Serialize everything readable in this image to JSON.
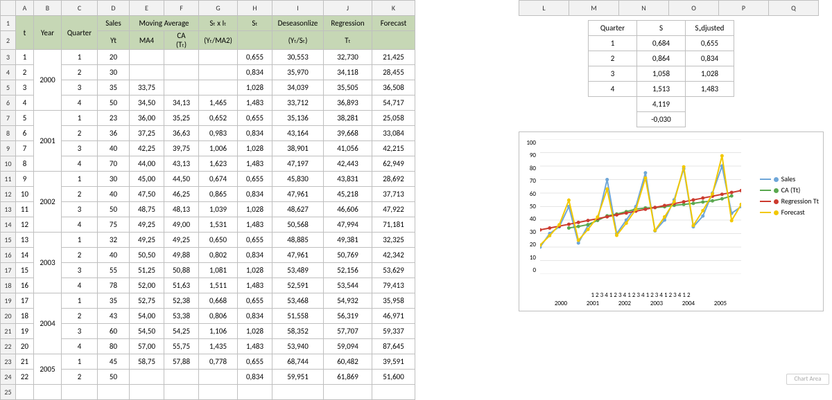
{
  "cols": [
    "A",
    "B",
    "C",
    "D",
    "E",
    "F",
    "G",
    "H",
    "I",
    "J",
    "K",
    "L",
    "M",
    "N",
    "O",
    "P",
    "Q"
  ],
  "highlight_col": 15,
  "headers": {
    "t": "t",
    "year": "Year",
    "quarter": "Quarter",
    "sales": "Sales",
    "ma": "Moving Average",
    "yt": "Yt",
    "ma4": "MA4",
    "ca": "CA\n(Tₜ)",
    "sxi": "Sₜ x Iₜ\n(Yₜ/MA2)",
    "st": "Sₜ",
    "deseason": "Deseasonlize\n(Yₜ/Sₜ)",
    "reg": "Regression\nTₜ",
    "forecast": "Forecast"
  },
  "rows": [
    {
      "n": 3,
      "t": "1",
      "yr": "2000",
      "q": "1",
      "yt": "20",
      "ma4": "",
      "ca": "",
      "sxi": "",
      "st": "0,655",
      "de": "30,553",
      "reg": "32,730",
      "f": "21,425"
    },
    {
      "n": 4,
      "t": "2",
      "yr": "",
      "q": "2",
      "yt": "30",
      "ma4": "",
      "ca": "",
      "sxi": "",
      "st": "0,834",
      "de": "35,970",
      "reg": "34,118",
      "f": "28,455"
    },
    {
      "n": 5,
      "t": "3",
      "yr": "",
      "q": "3",
      "yt": "35",
      "ma4": "33,75",
      "ca": "",
      "sxi": "",
      "st": "1,028",
      "de": "34,039",
      "reg": "35,505",
      "f": "36,508"
    },
    {
      "n": 6,
      "t": "4",
      "yr": "",
      "q": "4",
      "yt": "50",
      "ma4": "34,50",
      "ca": "34,13",
      "sxi": "1,465",
      "st": "1,483",
      "de": "33,712",
      "reg": "36,893",
      "f": "54,717"
    },
    {
      "n": 7,
      "t": "5",
      "yr": "2001",
      "q": "1",
      "yt": "23",
      "ma4": "36,00",
      "ca": "35,25",
      "sxi": "0,652",
      "st": "0,655",
      "de": "35,136",
      "reg": "38,281",
      "f": "25,058"
    },
    {
      "n": 8,
      "t": "6",
      "yr": "",
      "q": "2",
      "yt": "36",
      "ma4": "37,25",
      "ca": "36,63",
      "sxi": "0,983",
      "st": "0,834",
      "de": "43,164",
      "reg": "39,668",
      "f": "33,084"
    },
    {
      "n": 9,
      "t": "7",
      "yr": "",
      "q": "3",
      "yt": "40",
      "ma4": "42,25",
      "ca": "39,75",
      "sxi": "1,006",
      "st": "1,028",
      "de": "38,901",
      "reg": "41,056",
      "f": "42,215"
    },
    {
      "n": 10,
      "t": "8",
      "yr": "",
      "q": "4",
      "yt": "70",
      "ma4": "44,00",
      "ca": "43,13",
      "sxi": "1,623",
      "st": "1,483",
      "de": "47,197",
      "reg": "42,443",
      "f": "62,949"
    },
    {
      "n": 11,
      "t": "9",
      "yr": "2002",
      "q": "1",
      "yt": "30",
      "ma4": "45,00",
      "ca": "44,50",
      "sxi": "0,674",
      "st": "0,655",
      "de": "45,830",
      "reg": "43,831",
      "f": "28,692"
    },
    {
      "n": 12,
      "t": "10",
      "yr": "",
      "q": "2",
      "yt": "40",
      "ma4": "47,50",
      "ca": "46,25",
      "sxi": "0,865",
      "st": "0,834",
      "de": "47,961",
      "reg": "45,218",
      "f": "37,713"
    },
    {
      "n": 13,
      "t": "11",
      "yr": "",
      "q": "3",
      "yt": "50",
      "ma4": "48,75",
      "ca": "48,13",
      "sxi": "1,039",
      "st": "1,028",
      "de": "48,627",
      "reg": "46,606",
      "f": "47,922"
    },
    {
      "n": 14,
      "t": "12",
      "yr": "",
      "q": "4",
      "yt": "75",
      "ma4": "49,25",
      "ca": "49,00",
      "sxi": "1,531",
      "st": "1,483",
      "de": "50,568",
      "reg": "47,994",
      "f": "71,181"
    },
    {
      "n": 15,
      "t": "13",
      "yr": "2003",
      "q": "1",
      "yt": "32",
      "ma4": "49,25",
      "ca": "49,25",
      "sxi": "0,650",
      "st": "0,655",
      "de": "48,885",
      "reg": "49,381",
      "f": "32,325"
    },
    {
      "n": 16,
      "t": "14",
      "yr": "",
      "q": "2",
      "yt": "40",
      "ma4": "50,50",
      "ca": "49,88",
      "sxi": "0,802",
      "st": "0,834",
      "de": "47,961",
      "reg": "50,769",
      "f": "42,342"
    },
    {
      "n": 17,
      "t": "15",
      "yr": "",
      "q": "3",
      "yt": "55",
      "ma4": "51,25",
      "ca": "50,88",
      "sxi": "1,081",
      "st": "1,028",
      "de": "53,489",
      "reg": "52,156",
      "f": "53,629"
    },
    {
      "n": 18,
      "t": "16",
      "yr": "",
      "q": "4",
      "yt": "78",
      "ma4": "52,00",
      "ca": "51,63",
      "sxi": "1,511",
      "st": "1,483",
      "de": "52,591",
      "reg": "53,544",
      "f": "79,413"
    },
    {
      "n": 19,
      "t": "17",
      "yr": "2004",
      "q": "1",
      "yt": "35",
      "ma4": "52,75",
      "ca": "52,38",
      "sxi": "0,668",
      "st": "0,655",
      "de": "53,468",
      "reg": "54,932",
      "f": "35,958"
    },
    {
      "n": 20,
      "t": "18",
      "yr": "",
      "q": "2",
      "yt": "43",
      "ma4": "54,00",
      "ca": "53,38",
      "sxi": "0,806",
      "st": "0,834",
      "de": "51,558",
      "reg": "56,319",
      "f": "46,971"
    },
    {
      "n": 21,
      "t": "19",
      "yr": "",
      "q": "3",
      "yt": "60",
      "ma4": "54,50",
      "ca": "54,25",
      "sxi": "1,106",
      "st": "1,028",
      "de": "58,352",
      "reg": "57,707",
      "f": "59,337"
    },
    {
      "n": 22,
      "t": "20",
      "yr": "",
      "q": "4",
      "yt": "80",
      "ma4": "57,00",
      "ca": "55,75",
      "sxi": "1,435",
      "st": "1,483",
      "de": "53,940",
      "reg": "59,094",
      "f": "87,645"
    },
    {
      "n": 23,
      "t": "21",
      "yr": "2005",
      "q": "1",
      "yt": "45",
      "ma4": "58,75",
      "ca": "57,88",
      "sxi": "0,778",
      "st": "0,655",
      "de": "68,744",
      "reg": "60,482",
      "f": "39,591"
    },
    {
      "n": 24,
      "t": "22",
      "yr": "",
      "q": "2",
      "yt": "50",
      "ma4": "",
      "ca": "",
      "sxi": "",
      "st": "0,834",
      "de": "59,951",
      "reg": "61,869",
      "f": "51,600"
    }
  ],
  "year_spans": {
    "3": 4,
    "7": 4,
    "11": 4,
    "15": 4,
    "19": 4,
    "23": 2
  },
  "stable": {
    "hdr": [
      "Quarter",
      "S",
      "Sₐdjusted"
    ],
    "rows": [
      [
        "1",
        "0,684",
        "0,655"
      ],
      [
        "2",
        "0,864",
        "0,834"
      ],
      [
        "3",
        "1,058",
        "1,028"
      ],
      [
        "4",
        "1,513",
        "1,483"
      ],
      [
        "",
        "4,119",
        ""
      ],
      [
        "",
        "-0,030",
        ""
      ]
    ]
  },
  "chart_data": {
    "type": "line",
    "x": [
      1,
      2,
      3,
      4,
      5,
      6,
      7,
      8,
      9,
      10,
      11,
      12,
      13,
      14,
      15,
      16,
      17,
      18,
      19,
      20,
      21,
      22
    ],
    "x_tick_labels_top": [
      "1",
      "2",
      "3",
      "4",
      "1",
      "2",
      "3",
      "4",
      "1",
      "2",
      "3",
      "4",
      "1",
      "2",
      "3",
      "4",
      "1",
      "2",
      "3",
      "4",
      "1",
      "2"
    ],
    "x_tick_labels_bottom": [
      "2000",
      "2001",
      "2002",
      "2003",
      "2004",
      "2005"
    ],
    "ylim": [
      0,
      100
    ],
    "yticks": [
      0,
      10,
      20,
      30,
      40,
      50,
      60,
      70,
      80,
      90,
      100
    ],
    "series": [
      {
        "name": "Sales",
        "color": "#6ea6d8",
        "values": [
          20,
          30,
          35,
          50,
          23,
          36,
          40,
          70,
          30,
          40,
          50,
          75,
          32,
          40,
          55,
          78,
          35,
          43,
          60,
          80,
          45,
          50
        ]
      },
      {
        "name": "CA (Tt)",
        "color": "#5aa84f",
        "values": [
          null,
          null,
          null,
          34.13,
          35.25,
          36.63,
          39.75,
          43.13,
          44.5,
          46.25,
          48.13,
          49.0,
          49.25,
          49.88,
          50.88,
          51.63,
          52.38,
          53.38,
          54.25,
          55.75,
          57.88,
          null
        ]
      },
      {
        "name": "Regression Tt",
        "color": "#cc3b2f",
        "values": [
          32.73,
          34.12,
          35.51,
          36.89,
          38.28,
          39.67,
          41.06,
          42.44,
          43.83,
          45.22,
          46.61,
          47.99,
          49.38,
          50.77,
          52.16,
          53.54,
          54.93,
          56.32,
          57.71,
          59.09,
          60.48,
          61.87
        ]
      },
      {
        "name": "Forecast",
        "color": "#f2c800",
        "values": [
          21.43,
          28.46,
          36.51,
          54.72,
          25.06,
          33.08,
          42.22,
          62.95,
          28.69,
          37.71,
          47.92,
          71.18,
          32.33,
          42.34,
          53.63,
          79.41,
          35.96,
          46.97,
          59.34,
          87.65,
          39.59,
          51.6
        ]
      }
    ],
    "legend": [
      "Sales",
      "CA\n(Tt)",
      "Regression\nTt",
      "Forecast"
    ]
  },
  "chart_area_btn": "Chart Area"
}
